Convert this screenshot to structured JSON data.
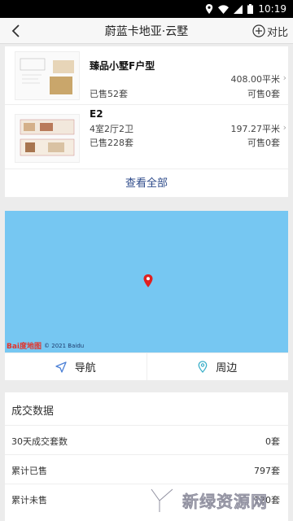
{
  "status_bar": {
    "time": "10:19"
  },
  "header": {
    "title": "蔚蓝卡地亚·云墅",
    "compare_label": "对比"
  },
  "units": [
    {
      "name": "臻品小墅F户型",
      "rooms": "",
      "area": "408.00平米",
      "sold": "已售52套",
      "available": "可售0套"
    },
    {
      "name": "E2",
      "rooms": "4室2厅2卫",
      "area": "197.27平米",
      "sold": "已售228套",
      "available": "可售0套"
    }
  ],
  "view_all_label": "查看全部",
  "map": {
    "logo": "Bai度地图",
    "copyright": "© 2021 Baidu"
  },
  "map_actions": {
    "navigate_label": "导航",
    "nearby_label": "周边"
  },
  "stats": {
    "title": "成交数据",
    "rows": [
      {
        "label": "30天成交套数",
        "value": "0套"
      },
      {
        "label": "累计已售",
        "value": "797套"
      },
      {
        "label": "累计未售",
        "value": "120套"
      }
    ]
  },
  "watermark": {
    "text": "新绿资源网",
    "sub": "www.xlhs.com"
  },
  "colors": {
    "accent_link": "#2d4a8a",
    "map_water": "#76c7f2",
    "pin": "#e02020",
    "nav_icon": "#4a7fd6",
    "nearby_icon": "#3cb0c9"
  }
}
